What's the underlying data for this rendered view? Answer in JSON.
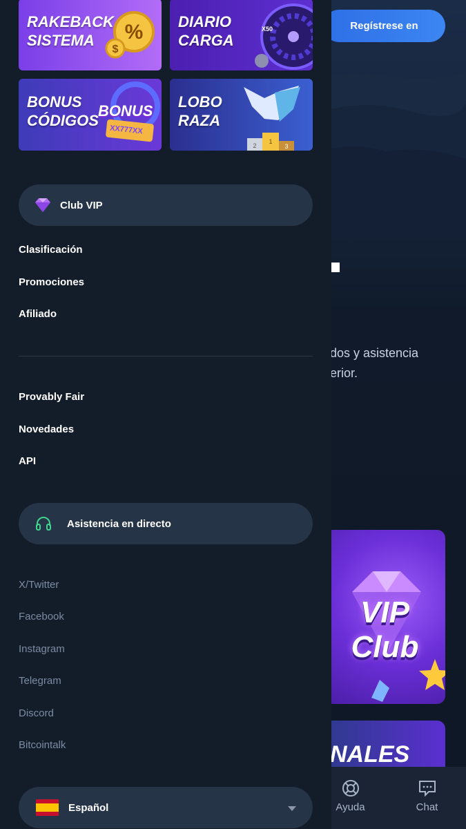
{
  "header": {
    "register_label": "Regístrese en"
  },
  "hero": {
    "text_fragment": "dos y asistencia\nerior."
  },
  "vip_card": {
    "label": "VIP Club"
  },
  "banner2": {
    "label": "NALES"
  },
  "bottom_nav": [
    {
      "label": "Ayuda",
      "icon": "lifebuoy-icon"
    },
    {
      "label": "Chat",
      "icon": "chat-bubble-icon"
    }
  ],
  "drawer": {
    "promos": [
      {
        "title": "RAKEBACK\nSISTEMA",
        "icon": "percent-coin-icon"
      },
      {
        "title": "DIARIO\nCARGA",
        "icon": "wheel-icon"
      },
      {
        "title": "BONUS\nCÓDIGOS",
        "icon": "bonus-ticket-icon",
        "badge": "BONUS",
        "code": "XX777XX"
      },
      {
        "title": "LOBO\nRAZA",
        "icon": "wolf-podium-icon"
      }
    ],
    "vip_button": {
      "label": "Club VIP",
      "icon": "diamond-icon"
    },
    "menu_primary": [
      "Clasificación",
      "Promociones",
      "Afiliado"
    ],
    "menu_secondary": [
      "Provably Fair",
      "Novedades",
      "API"
    ],
    "support_button": {
      "label": "Asistencia en directo",
      "icon": "headset-icon"
    },
    "social_links": [
      "X/Twitter",
      "Facebook",
      "Instagram",
      "Telegram",
      "Discord",
      "Bitcointalk"
    ],
    "language": {
      "label": "Español",
      "flag": "spain-flag-icon"
    }
  },
  "colors": {
    "drawer_bg": "#131c29",
    "pill_bg": "#263447",
    "accent_blue": "#3c86f3",
    "support_green": "#3dd68c"
  }
}
